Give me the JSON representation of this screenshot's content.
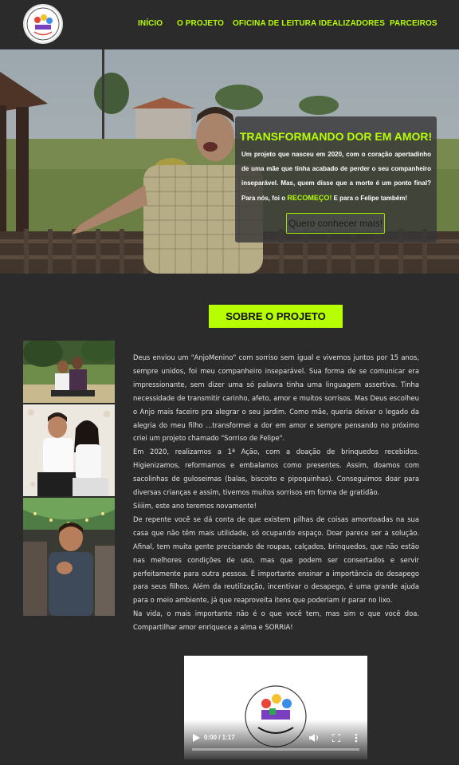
{
  "header": {
    "logo_icon": "sorriso-de-felipe-logo",
    "nav": [
      {
        "label": "INÍCIO"
      },
      {
        "label": "O PROJETO"
      },
      {
        "label": "OFICINA DE LEITURA"
      },
      {
        "label": "IDEALIZADORES"
      },
      {
        "label": "PARCEIROS"
      }
    ]
  },
  "hero": {
    "title": "TRANSFORMANDO DOR EM AMOR!",
    "text_before": "Um projeto que nasceu em 2020, com o coração apertadinho de uma mãe que tinha acabado de perder o seu companheiro inseparável. Mas, quem disse que a morte é um ponto final? Para nós, foi o ",
    "highlight": "RECOMEÇO!",
    "text_after": " E para o Felipe também!",
    "button_label": "Quero conhecer mais!"
  },
  "sobre": {
    "title": "SOBRE O PROJETO",
    "paragraphs": [
      "Deus enviou um \"AnjoMenino\" com sorriso sem igual e vivemos juntos por 15 anos, sempre unidos, foi meu companheiro inseparável. Sua forma de se comunicar era impressionante, sem dizer uma só palavra tinha uma linguagem assertiva. Tinha necessidade de transmitir carinho, afeto, amor e muitos sorrisos. Mas Deus escolheu o Anjo mais faceiro pra alegrar o seu jardim. Como mãe, queria deixar o legado da alegria do meu filho ...transformei a dor em amor e sempre pensando no próximo criei um projeto chamado \"Sorriso de Felipe\".",
      "Em 2020, realizamos a 1ª Ação, com a doação de brinquedos recebidos. Higienizamos, reformamos e embalamos como presentes. Assim, doamos com sacolinhas de guloseimas (balas, biscoito e pipoquinhas). Conseguimos doar para diversas crianças e assim, tivemos muitos sorrisos em forma de gratidão.",
      "Siiiim, este ano teremos novamente!",
      "De repente você se dá conta de que existem pilhas de coisas amontoadas na sua casa que não têm mais utilidade, só ocupando espaço. Doar parece ser a solução. Afinal, tem muita gente precisando de roupas, calçados, brinquedos, que não estão nas melhores condições de uso, mas que podem ser consertados e servir perfeitamente para outra pessoa. É importante ensinar a importância do desapego para seus filhos. Além da reutilização, incentivar o desapego, é uma grande ajuda para o meio ambiente, já que reaproveita itens que poderiam ir parar no lixo.",
      "Na vida, o mais importante não é o que você tem, mas sim o que você doa. Compartilhar amor enriquece a alma e SORRIA!"
    ]
  },
  "video": {
    "time": "0:00 / 1:17",
    "play_icon": "play-icon",
    "volume_icon": "volume-icon",
    "fullscreen_icon": "fullscreen-icon",
    "menu_icon": "more-vertical-icon"
  },
  "colors": {
    "accent": "#b7ff00",
    "background": "#2b2b2c"
  }
}
